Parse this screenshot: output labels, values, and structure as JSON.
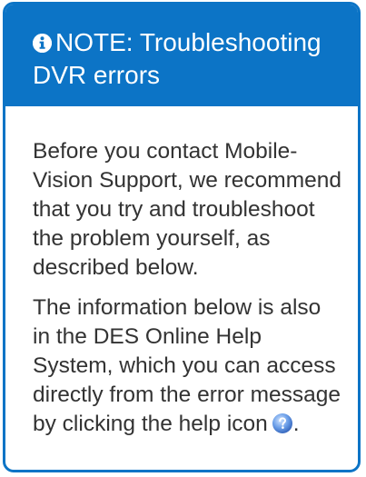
{
  "note": {
    "title": "NOTE: Troubleshooting DVR errors",
    "paragraph1": "Before you contact Mobile-Vision Support, we recommend that you try and troubleshoot the problem yourself, as described below.",
    "paragraph2_text": "The information below is also in the DES Online Help System, which you can access directly from the error message by clicking the help icon",
    "paragraph2_end": "."
  },
  "colors": {
    "accent": "#0c74c6",
    "body_text": "#333333"
  },
  "icons": {
    "title_icon": "info-circle-icon",
    "help_icon": "help-icon"
  }
}
